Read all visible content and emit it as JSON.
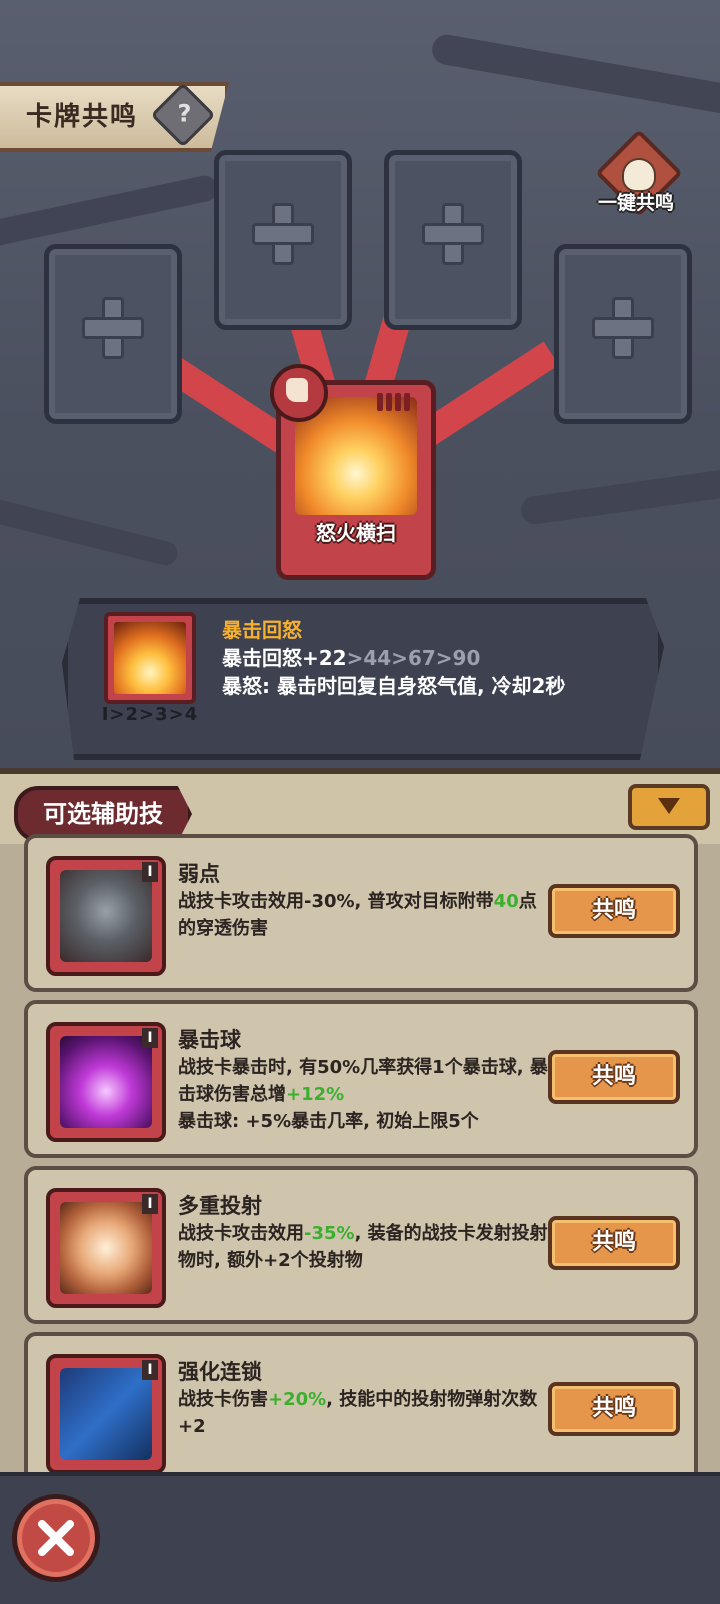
{
  "header": {
    "title": "卡牌共鸣",
    "help_glyph": "?"
  },
  "one_key": {
    "label": "一键共鸣"
  },
  "center_card": {
    "name": "怒火横扫"
  },
  "info_panel": {
    "title": "暴击回怒",
    "line1_prefix": "暴击回怒+22",
    "line1_rest": ">44>67>90",
    "line2": "暴怒: 暴击时回复自身怒气值, 冷却2秒",
    "levels": "I>2>3>4"
  },
  "drawer": {
    "title": "可选辅助技",
    "collapse_icon": "chevron-down-icon"
  },
  "skills": [
    {
      "level": "I",
      "name": "弱点",
      "desc_parts": [
        "战技卡攻击效用-30%, 普攻对目标附带",
        "40",
        "点的穿透伤害"
      ],
      "button": "共鸣",
      "icon": "broken-shield-icon"
    },
    {
      "level": "I",
      "name": "暴击球",
      "desc_parts": [
        "战技卡暴击时, 有50%几率获得1个暴击球, 暴击球伤害总增",
        "+12%",
        "暴击球: +5%暴击几率, 初始上限5个"
      ],
      "button": "共鸣",
      "icon": "purple-orb-icon"
    },
    {
      "level": "I",
      "name": "多重投射",
      "desc_parts": [
        "战技卡攻击效用",
        "-35%",
        ", 装备的战技卡发射投射物时, 额外+2个投射物"
      ],
      "button": "共鸣",
      "icon": "multi-projectile-icon"
    },
    {
      "level": "I",
      "name": "强化连锁",
      "desc_parts": [
        "战技卡伤害",
        "+20%",
        ", 技能中的投射物弹射次数+2"
      ],
      "button": "共鸣",
      "icon": "chain-arrow-icon"
    }
  ],
  "bottom": {
    "close_icon": "close-icon"
  },
  "colors": {
    "accent_gold": "#f5b030",
    "highlight_green": "#3bb02e",
    "card_red": "#c2434a",
    "button_orange": "#e5964a"
  }
}
